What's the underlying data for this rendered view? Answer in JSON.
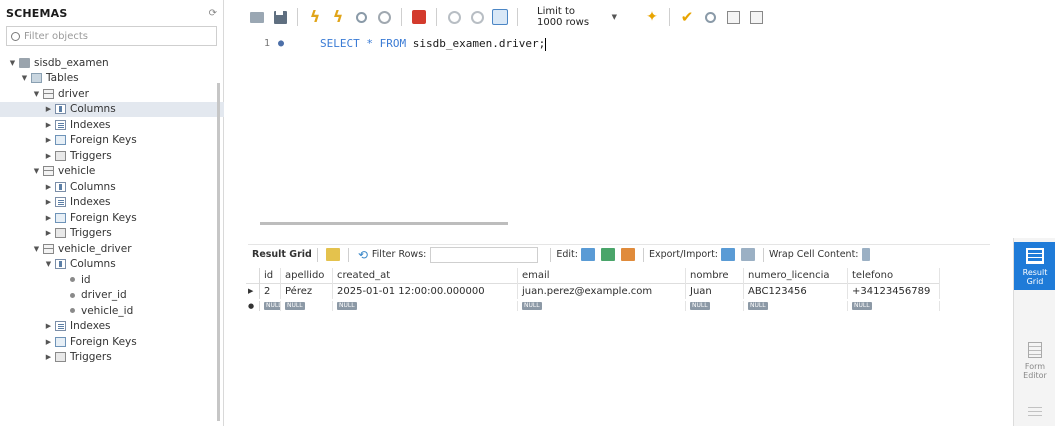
{
  "sidebar": {
    "title": "SCHEMAS",
    "filter_placeholder": "Filter objects",
    "tree": [
      {
        "level": 0,
        "expanded": true,
        "icon": "db",
        "label": "sisdb_examen"
      },
      {
        "level": 1,
        "expanded": true,
        "icon": "folder",
        "label": "Tables"
      },
      {
        "level": 2,
        "expanded": true,
        "icon": "table",
        "label": "driver"
      },
      {
        "level": 3,
        "expanded": false,
        "icon": "col",
        "label": "Columns",
        "selected": true
      },
      {
        "level": 3,
        "expanded": false,
        "icon": "idx",
        "label": "Indexes"
      },
      {
        "level": 3,
        "expanded": false,
        "icon": "fk",
        "label": "Foreign Keys"
      },
      {
        "level": 3,
        "expanded": false,
        "icon": "trg",
        "label": "Triggers"
      },
      {
        "level": 2,
        "expanded": true,
        "icon": "table",
        "label": "vehicle"
      },
      {
        "level": 3,
        "expanded": false,
        "icon": "col",
        "label": "Columns"
      },
      {
        "level": 3,
        "expanded": false,
        "icon": "idx",
        "label": "Indexes"
      },
      {
        "level": 3,
        "expanded": false,
        "icon": "fk",
        "label": "Foreign Keys"
      },
      {
        "level": 3,
        "expanded": false,
        "icon": "trg",
        "label": "Triggers"
      },
      {
        "level": 2,
        "expanded": true,
        "icon": "table",
        "label": "vehicle_driver"
      },
      {
        "level": 3,
        "expanded": true,
        "icon": "col",
        "label": "Columns"
      },
      {
        "level": 4,
        "leaf": true,
        "icon": "dot",
        "label": "id"
      },
      {
        "level": 4,
        "leaf": true,
        "icon": "dot",
        "label": "driver_id"
      },
      {
        "level": 4,
        "leaf": true,
        "icon": "dot",
        "label": "vehicle_id"
      },
      {
        "level": 3,
        "expanded": false,
        "icon": "idx",
        "label": "Indexes"
      },
      {
        "level": 3,
        "expanded": false,
        "icon": "fk",
        "label": "Foreign Keys"
      },
      {
        "level": 3,
        "expanded": false,
        "icon": "trg",
        "label": "Triggers"
      }
    ]
  },
  "toolbar": {
    "limit_label": "Limit to 1000 rows",
    "icons": [
      "open-folder-icon",
      "save-icon",
      "execute-icon",
      "execute-current-icon",
      "explain-icon",
      "stop-icon",
      "error-toggle-icon",
      "commit-icon",
      "rollback-icon",
      "autocommit-icon",
      "beautify-icon",
      "check-icon",
      "find-icon",
      "invisible-chars-icon",
      "wrap-icon"
    ]
  },
  "editor": {
    "line_number": "1",
    "sql_keyword_select": "SELECT",
    "sql_star": " * ",
    "sql_keyword_from": "FROM",
    "sql_rest": " sisdb_examen.driver;"
  },
  "result_toolbar": {
    "result_grid_label": "Result Grid",
    "filter_rows_label": "Filter Rows:",
    "edit_label": "Edit:",
    "export_label": "Export/Import:",
    "wrap_label": "Wrap Cell Content:"
  },
  "grid": {
    "columns": [
      "id",
      "apellido",
      "created_at",
      "email",
      "nombre",
      "numero_licencia",
      "telefono"
    ],
    "rows": [
      {
        "id": "2",
        "apellido": "Pérez",
        "created_at": "2025-01-01 12:00:00.000000",
        "email": "juan.perez@example.com",
        "nombre": "Juan",
        "numero_licencia": "ABC123456",
        "telefono": "+34123456789"
      }
    ],
    "null_label": "NULL"
  },
  "side_panel": {
    "result_grid_tab": "Result Grid",
    "form_editor_tab": "Form Editor"
  }
}
